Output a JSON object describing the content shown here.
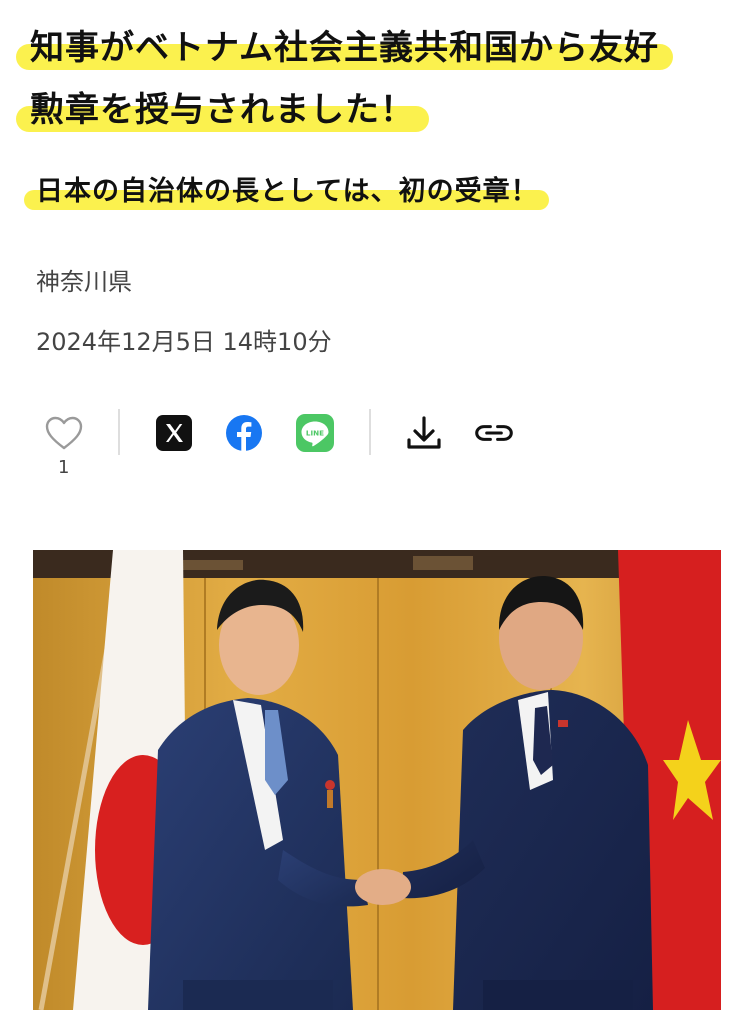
{
  "headline": {
    "line1": "知事がベトナム社会主義共和国から友好",
    "line2": "勲章を授与されました！"
  },
  "subheadline": "日本の自治体の長としては、初の受章！",
  "prefecture": "神奈川県",
  "datetime": "2024年12月5日 14時10分",
  "actions": {
    "like_count": "1",
    "icons": [
      "heart-icon",
      "x-icon",
      "facebook-icon",
      "line-icon",
      "download-icon",
      "link-icon"
    ],
    "line_label": "LINE"
  },
  "colors": {
    "highlight": "#fbf03b",
    "facebook": "#1877f2",
    "line": "#4cc764"
  }
}
